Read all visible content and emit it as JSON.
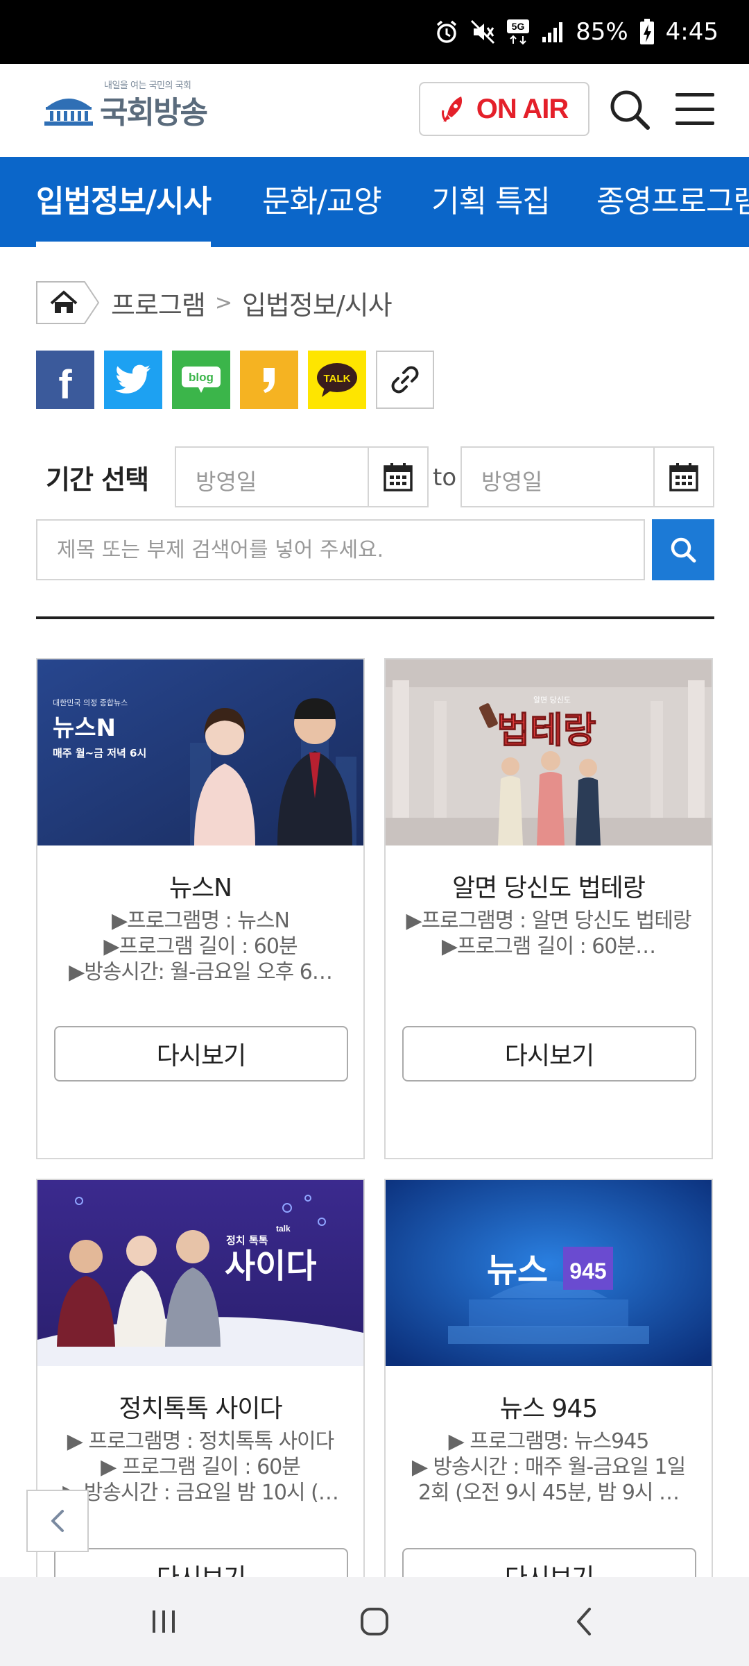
{
  "status_bar": {
    "battery": "85%",
    "time": "4:45",
    "network": "5G",
    "icons": [
      "alarm-icon",
      "mute-icon",
      "5g-icon",
      "signal-icon",
      "battery-charging-icon"
    ]
  },
  "header": {
    "logo_text": "국회방송",
    "logo_tagline": "내일을 여는 국민의 국회",
    "onair_label": "ON AIR",
    "icons": [
      "rocket-icon",
      "search-icon",
      "menu-icon"
    ]
  },
  "nav": {
    "tabs": [
      {
        "label": "입법정보/시사",
        "active": true
      },
      {
        "label": "문화/교양",
        "active": false
      },
      {
        "label": "기획 특집",
        "active": false
      },
      {
        "label": "종영프로그램",
        "active": false
      }
    ]
  },
  "breadcrumb": {
    "items": [
      "프로그램",
      "입법정보/시사"
    ],
    "separator": ">"
  },
  "share": {
    "blog_label": "blog",
    "kakao_label": "TALK",
    "buttons": [
      "facebook-icon",
      "twitter-icon",
      "blog-icon",
      "kakaostory-icon",
      "kakaotalk-icon",
      "link-icon"
    ]
  },
  "filter": {
    "period_label": "기간 선택",
    "start_placeholder": "방영일",
    "to_label": "to",
    "end_placeholder": "방영일",
    "search_placeholder": "제목 또는 부제 검색어를 넣어 주세요."
  },
  "programs": [
    {
      "title": "뉴스N",
      "thumb": {
        "kicker": "대한민국 의정 종합뉴스",
        "name": "뉴스N",
        "schedule": "매주 월~금 저녁 6시"
      },
      "desc": [
        "▶프로그램명 : 뉴스N",
        "▶프로그램 길이 : 60분",
        "▶방송시간: 월-금요일 오후 6…"
      ],
      "button": "다시보기"
    },
    {
      "title": "알면 당신도 법테랑",
      "thumb": {
        "kicker": "알면 당신도",
        "name": "법테랑"
      },
      "desc": [
        "▶프로그램명 : 알면 당신도 법테랑",
        "▶프로그램 길이 : 60분…"
      ],
      "button": "다시보기"
    },
    {
      "title": "정치톡톡 사이다",
      "thumb": {
        "kicker": "정치 톡톡",
        "badge": "talk",
        "name": "사이다"
      },
      "desc": [
        "▶ 프로그램명 : 정치톡톡 사이다",
        "▶ 프로그램 길이 : 60분",
        "▶ 방송시간 : 금요일 밤 10시 (…"
      ],
      "button": "다시보기"
    },
    {
      "title": "뉴스 945",
      "thumb": {
        "name": "뉴스",
        "badge": "945"
      },
      "desc": [
        "▶ 프로그램명: 뉴스945",
        "▶ 방송시간 : 매주 월-금요일 1일 2회 (오전 9시 45분, 밤 9시 …"
      ],
      "button": "다시보기"
    }
  ],
  "colors": {
    "nav_blue": "#0b66c9",
    "onair_red": "#e4202a",
    "search_blue": "#1c7ad6"
  }
}
